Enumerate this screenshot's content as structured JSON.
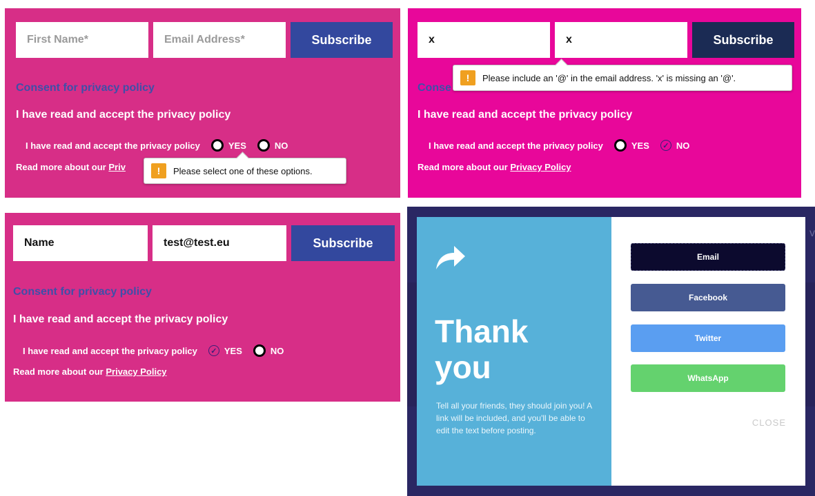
{
  "form1": {
    "first_name_placeholder": "First Name*",
    "email_placeholder": "Email Address*",
    "subscribe_label": "Subscribe",
    "consent_heading": "Consent for privacy policy",
    "accept_text": "I have read and accept the privacy policy",
    "radio_label": "I have read and accept the privacy policy",
    "yes_label": "YES",
    "no_label": "NO",
    "read_more": "Read more about our ",
    "read_more_link_visible": "Priv",
    "tooltip": "Please select one of these options.",
    "tooltip_icon": "!"
  },
  "form2": {
    "first_name_value": "x",
    "email_value": "x",
    "subscribe_label": "Subscribe",
    "consent_heading_visible": "Conse",
    "accept_text": "I have read and accept the privacy policy",
    "radio_label": "I have read and accept the privacy policy",
    "yes_label": "YES",
    "no_label": "NO",
    "read_more": "Read more about our ",
    "read_more_link": "Privacy Policy",
    "tooltip": "Please include an '@' in the email address. 'x' is missing an '@'.",
    "tooltip_icon": "!",
    "selected_option": "NO"
  },
  "form3": {
    "name_value": "Name",
    "email_value": "test@test.eu",
    "subscribe_label": "Subscribe",
    "consent_heading": "Consent for privacy policy",
    "accept_text": "I have read and accept the privacy policy",
    "radio_label": "I have read and accept the privacy policy",
    "yes_label": "YES",
    "no_label": "NO",
    "read_more": "Read more about our ",
    "read_more_link": "Privacy Policy",
    "selected_option": "YES"
  },
  "share_modal": {
    "thank_line1": "Thank",
    "thank_line2": "you",
    "message": "Tell all your friends, they should join you! A link will be included, and you'll be able to edit the text before posting.",
    "buttons": {
      "email": "Email",
      "facebook": "Facebook",
      "twitter": "Twitter",
      "whatsapp": "WhatsApp"
    },
    "close_label": "CLOSE",
    "background_fragment": "v",
    "icon": "share-arrow-icon"
  },
  "colors": {
    "form_pink": "#d72e87",
    "form_magenta": "#e8079a",
    "subscribe_blue": "#33489e",
    "subscribe_navy": "#1b2b54",
    "modal_left_blue": "#57b1d9",
    "email_btn": "#0c0a2e",
    "facebook_btn": "#465a92",
    "twitter_btn": "#5a9ef1",
    "whatsapp_btn": "#64d26e",
    "warning_orange": "#f0a020"
  }
}
